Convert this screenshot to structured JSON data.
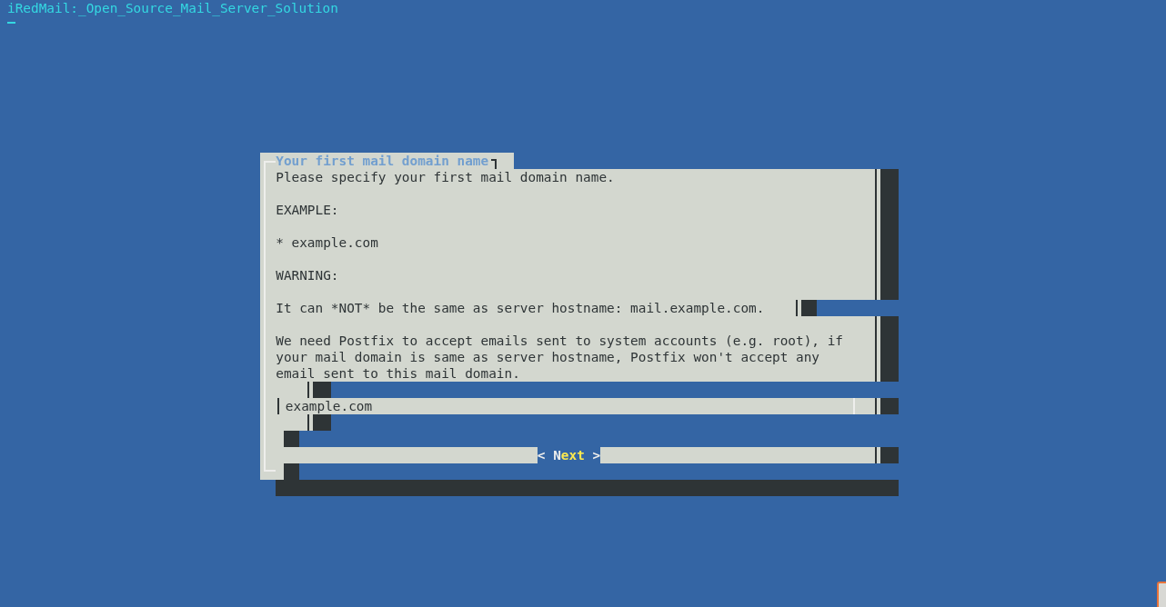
{
  "terminal": {
    "title": "iRedMail:_Open_Source_Mail_Server_Solution"
  },
  "dialog": {
    "title": "Your first mail domain name",
    "paragraphs": [
      {
        "lines": [
          "Please specify your first mail domain name."
        ]
      },
      {
        "lines": [
          "EXAMPLE:"
        ]
      },
      {
        "lines": [
          "* example.com"
        ]
      },
      {
        "lines": [
          "WARNING:"
        ]
      },
      {
        "lines": [
          "It can *NOT* be the same as server hostname: mail.example.com."
        ]
      },
      {
        "lines": [
          "We need Postfix to accept emails sent to system accounts (e.g. root), if",
          "your mail domain is same as server hostname, Postfix won't accept any",
          "email sent to this mail domain."
        ]
      }
    ],
    "input": {
      "value": "example.com"
    },
    "buttons": [
      {
        "open": "<",
        "label": "Next",
        "close": ">",
        "selected": true
      }
    ]
  }
}
